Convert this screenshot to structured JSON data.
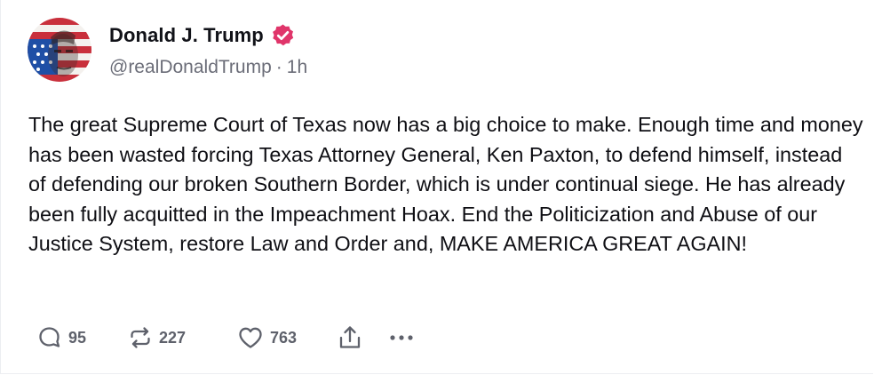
{
  "author": {
    "display_name": "Donald J. Trump",
    "handle": "@realDonaldTrump",
    "separator": "·",
    "timestamp": "1h",
    "verified": true,
    "avatar_icon": "flag-portrait-avatar",
    "verified_color": "#e0356a"
  },
  "post": {
    "text": "The great Supreme Court of Texas now has a big choice to make. Enough time and money has been wasted forcing Texas Attorney General, Ken Paxton, to defend himself, instead of defending our broken Southern Border, which is under continual siege. He has already been fully acquitted in the Impeachment Hoax. End the Politicization and Abuse of our Justice System, restore Law and Order and, MAKE AMERICA GREAT AGAIN!"
  },
  "actions": {
    "replies": "95",
    "retruths": "227",
    "likes": "763",
    "icons": [
      "reply-icon",
      "retruth-icon",
      "heart-icon",
      "share-icon",
      "more-icon"
    ]
  }
}
